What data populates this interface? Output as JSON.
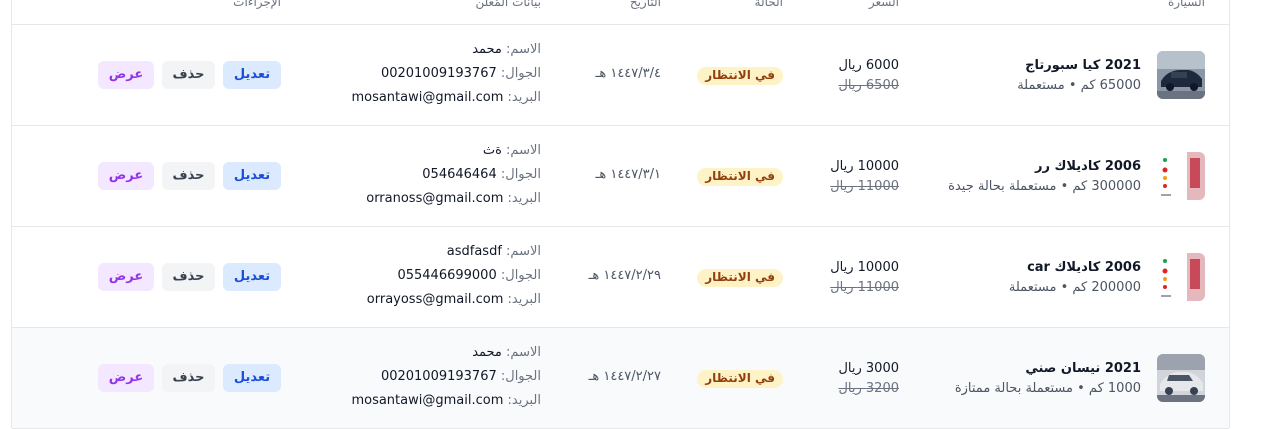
{
  "headers": {
    "car": "السيارة",
    "price": "السعر",
    "status": "الحالة",
    "date": "التاريخ",
    "seller": "بيانات المُعلن",
    "actions": "الإجراءات"
  },
  "labels": {
    "name": "الاسم:",
    "phone": "الجوال:",
    "email": "البريد:"
  },
  "buttons": {
    "edit": "تعديل",
    "delete": "حذف",
    "view": "عرض"
  },
  "rows": [
    {
      "title": "2021 كيا سبورتاج",
      "subtitle": "65000 كم • مستعملة",
      "price": "6000 ريال",
      "old_price": "6500 ريال",
      "status": "في الانتظار",
      "date": "١٤٤٧/٣/٤ هـ",
      "name": "محمد",
      "phone": "00201009193767",
      "email": "mosantawi@gmail.com",
      "thumb": "dark-car-photo"
    },
    {
      "title": "2006 كاديلاك رر",
      "subtitle": "300000 كم • مستعملة بحالة جيدة",
      "price": "10000 ريال",
      "old_price": "11000 ريال",
      "status": "في الانتظار",
      "date": "١٤٤٧/٣/١ هـ",
      "name": "ةث",
      "phone": "054646464",
      "email": "orranoss@gmail.com",
      "thumb": "red-graphic-photo"
    },
    {
      "title": "2006 كاديلاك car",
      "subtitle": "200000 كم • مستعملة",
      "price": "10000 ريال",
      "old_price": "11000 ريال",
      "status": "في الانتظار",
      "date": "١٤٤٧/٢/٢٩ هـ",
      "name": "asdfasdf",
      "phone": "055446699000",
      "email": "orrayoss@gmail.com",
      "thumb": "red-graphic-photo"
    },
    {
      "title": "2021 نيسان صني",
      "subtitle": "1000 كم • مستعملة بحالة ممتازة",
      "price": "3000 ريال",
      "old_price": "3200 ريال",
      "status": "في الانتظار",
      "date": "١٤٤٧/٢/٢٧ هـ",
      "name": "محمد",
      "phone": "00201009193767",
      "email": "mosantawi@gmail.com",
      "thumb": "silver-car-photo"
    }
  ]
}
